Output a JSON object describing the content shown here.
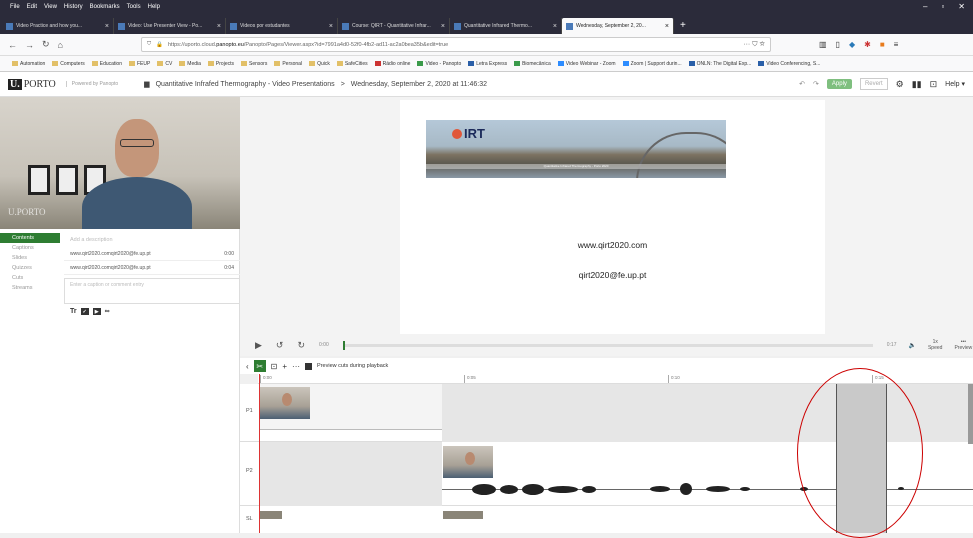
{
  "browser": {
    "menu": [
      "File",
      "Edit",
      "View",
      "History",
      "Bookmarks",
      "Tools",
      "Help"
    ],
    "tabs": [
      {
        "label": "Video Practice and how you..."
      },
      {
        "label": "Video: Use Presenter View - Po..."
      },
      {
        "label": "Videos por estudantes"
      },
      {
        "label": "Course: QIRT - Quantitative Infrar..."
      },
      {
        "label": "Quantitative Infrared Thermo..."
      },
      {
        "label": "Wednesday, September 2, 20..."
      }
    ],
    "url_prefix": "https://uporto.cloud.",
    "url_host": "panopto.eu",
    "url_path": "/Panopto/Pages/Viewer.aspx?id=7991a4d0-52f0-4fb2-ad11-ac2a0bea35b&edit=true",
    "url_right": "··· ⛉ ☆",
    "bookmarks": [
      "Automation",
      "Computers",
      "Education",
      "FEUP",
      "CV",
      "Media",
      "Projects",
      "Sensors",
      "Personal",
      "Quick",
      "SafeCities",
      "Rádio online",
      "Video - Panopto",
      "Letra Express",
      "Biomecânica",
      "Video Webinar - Zoom",
      "Zoom | Support durin...",
      "ONLN: The Digital Exp...",
      "Video Conferencing, S..."
    ]
  },
  "app": {
    "logo_u": "U.",
    "logo_text": "PORTO",
    "powered_by": "Powered by Panopto",
    "breadcrumb_folder": "Quantitative Infrafed Thermography - Video Presentations",
    "breadcrumb_sep": ">",
    "breadcrumb_session": "Wednesday, September 2, 2020 at 11:46:32",
    "undo": "↶",
    "redo": "↷",
    "apply": "Apply",
    "revert": "Revert",
    "help": "Help ▾"
  },
  "sidebar": {
    "items": [
      "Contents",
      "Captions",
      "Slides",
      "Quizzes",
      "Cuts",
      "Streams"
    ],
    "active": "Contents"
  },
  "contents": {
    "description_placeholder": "Add a description",
    "rows": [
      {
        "text": "www.qirt2020.comqirt2020@fe.up.pt",
        "time": "0:00"
      },
      {
        "text": "www.qirt2020.comqirt2020@fe.up.pt",
        "time": "0:04"
      }
    ],
    "comment_placeholder": "Enter a caption or comment entry",
    "tools": [
      "Tr",
      "■",
      "■",
      "∞"
    ]
  },
  "webcam": {
    "watermark": "U.PORTO"
  },
  "slide": {
    "banner_title": "IRT",
    "banner_strip": "Quantitative Infrared Thermography - Porto 2020",
    "website": "www.qirt2020.com",
    "email": "qirt2020@fe.up.pt"
  },
  "player": {
    "current_time": "0:00",
    "end_time": "0:17",
    "speed": "1x",
    "speed_label": "Speed",
    "preview_label": "Preview",
    "more": "•••"
  },
  "timeline": {
    "preview_cuts_label": "Preview cuts during playback",
    "ruler": [
      "0:00",
      "0:05",
      "0:10",
      "0:15"
    ],
    "tracks": [
      {
        "label": "P1"
      },
      {
        "label": "P2"
      },
      {
        "label": "SL"
      }
    ]
  },
  "colors": {
    "accent": "#2e7d32",
    "annotation": "#cc0000",
    "browser_chrome": "#2b2b3a"
  }
}
